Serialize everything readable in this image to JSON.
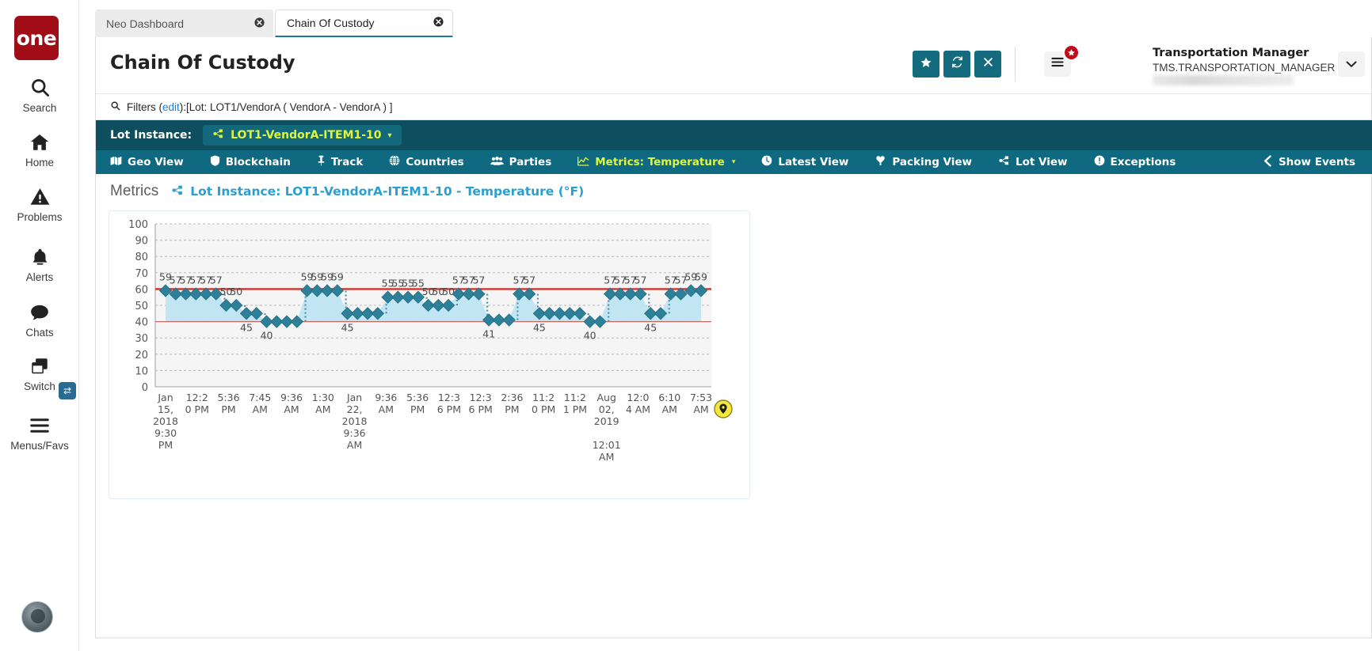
{
  "brand": {
    "logo_text": "one"
  },
  "sidebar": {
    "items": [
      {
        "label": "Search",
        "icon": "search-icon"
      },
      {
        "label": "Home",
        "icon": "home-icon"
      },
      {
        "label": "Problems",
        "icon": "warning-triangle-icon"
      },
      {
        "label": "Alerts",
        "icon": "bell-icon"
      },
      {
        "label": "Chats",
        "icon": "chat-bubble-icon"
      },
      {
        "label": "Switch",
        "icon": "windows-stack-icon"
      },
      {
        "label": "Menus/Favs",
        "icon": "hamburger-icon"
      }
    ],
    "switch_badge_icon": "swap-arrows-icon"
  },
  "tabs": [
    {
      "title": "Neo Dashboard",
      "active": false,
      "close_icon": "close-circle-icon"
    },
    {
      "title": "Chain Of Custody",
      "active": true,
      "close_icon": "close-circle-icon"
    }
  ],
  "header": {
    "title": "Chain Of Custody",
    "buttons": [
      {
        "name": "favorite-button",
        "icon": "star-icon"
      },
      {
        "name": "refresh-button",
        "icon": "refresh-icon"
      },
      {
        "name": "close-button",
        "icon": "x-icon"
      }
    ],
    "menu_fav_icon": "hamburger-icon",
    "menu_fav_badge_icon": "star-icon",
    "user_name": "Transportation Manager",
    "user_role": "TMS.TRANSPORTATION_MANAGER",
    "user_caret_icon": "chevron-down-icon"
  },
  "filters": {
    "icon": "search-icon",
    "prefix": "Filters (",
    "edit_label": "edit",
    "suffix": "):[Lot: LOT1/VendorA ( VendorA - VendorA ) ]",
    "full_text": "Filters (edit):[Lot: LOT1/VendorA ( VendorA - VendorA ) ]"
  },
  "lot_bar": {
    "label": "Lot Instance:",
    "chip_icon": "share-nodes-icon",
    "chip_text": "LOT1-VendorA-ITEM1-10",
    "chip_caret": "▾"
  },
  "nav": {
    "items": [
      {
        "label": "Geo View",
        "icon": "map-icon",
        "active": false
      },
      {
        "label": "Blockchain",
        "icon": "shield-icon",
        "active": false
      },
      {
        "label": "Track",
        "icon": "pin-icon",
        "active": false
      },
      {
        "label": "Countries",
        "icon": "globe-icon",
        "active": false
      },
      {
        "label": "Parties",
        "icon": "people-icon",
        "active": false
      },
      {
        "label": "Metrics: Temperature",
        "icon": "chart-line-icon",
        "active": true,
        "caret": "▾"
      },
      {
        "label": "Latest View",
        "icon": "clock-icon",
        "active": false
      },
      {
        "label": "Packing View",
        "icon": "package-icon",
        "active": false
      },
      {
        "label": "Lot View",
        "icon": "share-nodes-icon",
        "active": false
      },
      {
        "label": "Exceptions",
        "icon": "exclamation-circle-icon",
        "active": false
      }
    ],
    "show_events_label": "Show Events",
    "show_events_icon": "chevron-left-icon"
  },
  "metrics": {
    "heading": "Metrics",
    "subtitle_icon": "share-nodes-icon",
    "subtitle": "Lot Instance: LOT1-VendorA-ITEM1-10 - Temperature (°F)",
    "map_pin_icon": "map-marker-icon"
  },
  "chart_data": {
    "type": "line",
    "title": "Lot Instance: LOT1-VendorA-ITEM1-10 - Temperature (°F)",
    "xlabel": "",
    "ylabel": "",
    "ylim": [
      0,
      100
    ],
    "yticks": [
      0,
      10,
      20,
      30,
      40,
      50,
      60,
      70,
      80,
      90,
      100
    ],
    "grid": true,
    "legend": "none",
    "series_color": "#2b7f96",
    "area_color": "#bfe4f2",
    "marker": "diamond",
    "threshold_lines": [
      {
        "value": 60,
        "color": "#d0342c",
        "label": "upper"
      },
      {
        "value": 40,
        "color": "#c06a66",
        "label": "lower"
      }
    ],
    "xtick_labels": [
      "Jan 15, 2018 9:30 PM",
      "12:20 PM",
      "5:36 PM",
      "7:45 AM",
      "9:36 AM",
      "1:30 AM",
      "Jan 22, 2018 9:36 AM",
      "9:36 AM",
      "5:36 PM",
      "12:36 PM",
      "12:36 PM",
      "2:36 PM",
      "11:20 PM",
      "11:21 PM",
      "Aug 02, 2019 12:01 AM",
      "12:04 AM",
      "6:10 AM",
      "7:53 AM"
    ],
    "xtick_lines": [
      [
        "Jan",
        "15,",
        "2018",
        "9:30",
        "PM"
      ],
      [
        "12:2",
        "0 PM"
      ],
      [
        "5:36",
        "PM"
      ],
      [
        "7:45",
        "AM"
      ],
      [
        "9:36",
        "AM"
      ],
      [
        "1:30",
        "AM"
      ],
      [
        "Jan",
        "22,",
        "2018",
        "9:36",
        "AM"
      ],
      [
        "9:36",
        "AM"
      ],
      [
        "5:36",
        "PM"
      ],
      [
        "12:3",
        "6 PM"
      ],
      [
        "12:3",
        "6 PM"
      ],
      [
        "2:36",
        "PM"
      ],
      [
        "11:2",
        "0 PM"
      ],
      [
        "11:2",
        "1 PM"
      ],
      [
        "Aug",
        "02,",
        "2019",
        "",
        "12:01",
        "AM"
      ],
      [
        "12:0",
        "4 AM"
      ],
      [
        "6:10",
        "AM"
      ],
      [
        "7:53",
        "AM"
      ]
    ],
    "values": [
      59,
      57,
      57,
      57,
      57,
      57,
      50,
      50,
      45,
      45,
      40,
      40,
      40,
      40,
      59,
      59,
      59,
      59,
      45,
      45,
      45,
      45,
      55,
      55,
      55,
      55,
      50,
      50,
      50,
      57,
      57,
      57,
      41,
      41,
      41,
      57,
      57,
      45,
      45,
      45,
      45,
      45,
      40,
      40,
      57,
      57,
      57,
      57,
      45,
      45,
      57,
      57,
      59,
      59
    ],
    "visible_point_labels": [
      {
        "text": "59",
        "value": 59
      },
      {
        "text": "57",
        "value": 57
      },
      {
        "text": "50",
        "value": 50
      },
      {
        "text": "45",
        "value": 45
      },
      {
        "text": "40",
        "value": 40
      },
      {
        "text": "55",
        "value": 55
      },
      {
        "text": "41",
        "value": 41
      }
    ]
  }
}
